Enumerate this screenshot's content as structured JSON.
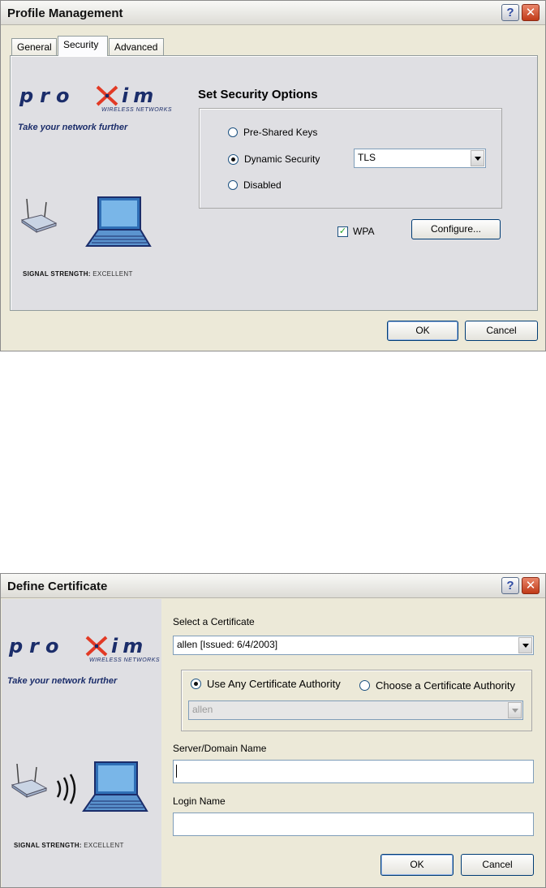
{
  "profile_window": {
    "title": "Profile Management",
    "tabs": [
      {
        "label": "General"
      },
      {
        "label": "Security"
      },
      {
        "label": "Advanced"
      }
    ],
    "active_tab": "Security",
    "logo": {
      "name": "proxim",
      "sub": "WIRELESS NETWORKS",
      "tagline": "Take your network further"
    },
    "signal_label": "SIGNAL STRENGTH:",
    "signal_value": "EXCELLENT",
    "section_title": "Set Security Options",
    "options": [
      {
        "label": "Pre-Shared Keys",
        "selected": false
      },
      {
        "label": "Dynamic Security",
        "selected": true
      },
      {
        "label": "Disabled",
        "selected": false
      }
    ],
    "dynamic_type": "TLS",
    "wpa_label": "WPA",
    "wpa_checked": true,
    "configure_label": "Configure...",
    "ok_label": "OK",
    "cancel_label": "Cancel"
  },
  "cert_window": {
    "title": "Define Certificate",
    "logo": {
      "name": "proxim",
      "sub": "WIRELESS NETWORKS",
      "tagline": "Take your network further"
    },
    "signal_label": "SIGNAL STRENGTH:",
    "signal_value": "EXCELLENT",
    "select_cert_label": "Select a Certificate",
    "selected_cert": "allen  [Issued: 6/4/2003]",
    "authority_options": [
      {
        "label": "Use Any Certificate Authority",
        "selected": true
      },
      {
        "label": "Choose a Certificate Authority",
        "selected": false
      }
    ],
    "authority_value": "allen",
    "server_label": "Server/Domain Name",
    "server_value": "",
    "login_label": "Login Name",
    "login_value": "",
    "ok_label": "OK",
    "cancel_label": "Cancel"
  },
  "colors": {
    "dialog_bg": "#ece9d8",
    "panel_bg": "#dfdfe3",
    "brand_navy": "#1b2d6a",
    "brand_red": "#e23a25",
    "close_red": "#c03a18"
  },
  "icons": [
    "help-icon",
    "close-icon",
    "access-point-icon",
    "laptop-icon",
    "signal-waves-icon",
    "chevron-down-icon"
  ]
}
